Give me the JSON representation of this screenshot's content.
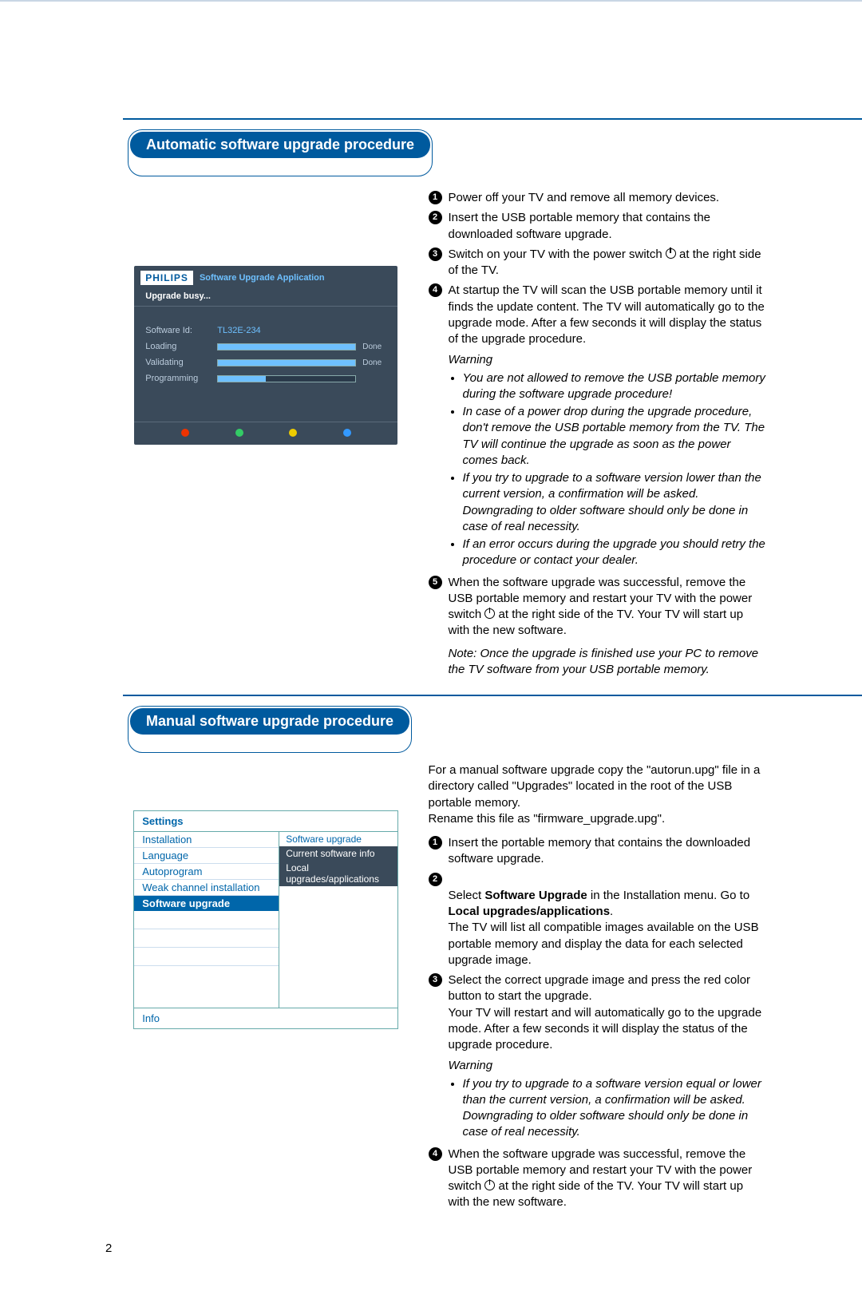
{
  "page_number": "2",
  "section1": {
    "title": "Automatic software upgrade procedure",
    "tv": {
      "brand": "PHILIPS",
      "app_title": "Software Upgrade Application",
      "status": "Upgrade busy...",
      "software_id_label": "Software Id:",
      "software_id_value": "TL32E-234",
      "loading_label": "Loading",
      "loading_done": "Done",
      "loading_pct": 100,
      "validating_label": "Validating",
      "validating_done": "Done",
      "validating_pct": 100,
      "programming_label": "Programming",
      "programming_pct": 35
    },
    "steps": {
      "1": "Power off your TV and remove all memory devices.",
      "2": "Insert the USB portable memory that contains the downloaded software upgrade.",
      "3_a": "Switch on your TV with the power switch ",
      "3_b": " at the right side of the TV.",
      "4": "At startup the TV will scan the USB portable memory until it finds the update content. The TV will automatically go to the upgrade mode. After a few seconds it will display the status of the upgrade procedure.",
      "warning_label": "Warning",
      "warnings": [
        "You are not allowed to remove the USB portable memory during the software upgrade procedure!",
        "In case of a power drop during the upgrade procedure, don't remove the USB portable memory from the TV. The TV will continue the upgrade as soon as the power comes back.",
        "If you try to upgrade to a software version lower than the current version, a confirmation will be asked. Downgrading to older software should only be done in case of real necessity.",
        "If an error occurs during the upgrade you should retry the procedure or contact your dealer."
      ],
      "5_a": "When the software upgrade was successful, remove the USB portable memory and restart your TV with the power switch ",
      "5_b": " at the right side of the TV. Your TV will start up with the new software.",
      "note": "Note: Once the upgrade is finished use your PC to remove the TV software from your USB portable memory."
    }
  },
  "section2": {
    "title": "Manual software upgrade procedure",
    "intro": "For a manual software upgrade copy the \"autorun.upg\" file in a directory called \"Upgrades\" located in the root of the USB portable memory.\nRename this file as \"firmware_upgrade.upg\".",
    "menu": {
      "header": "Settings",
      "left": [
        "Installation",
        "Language",
        "Autoprogram",
        "Weak channel installation",
        "Software upgrade"
      ],
      "left_active_index": 4,
      "right": [
        "Software upgrade",
        "Current software info",
        "Local upgrades/applications"
      ],
      "footer": "Info"
    },
    "steps": {
      "1": "Insert the portable memory that contains the downloaded software upgrade.",
      "2_a": "Select ",
      "2_bold1": "Software Upgrade",
      "2_b": " in the Installation menu. Go to ",
      "2_bold2": "Local upgrades/applications",
      "2_c": ".\nThe TV will list all compatible images available on the USB portable memory and display the data for each selected upgrade image.",
      "3": "Select the correct upgrade image and press the red color button to start the upgrade.\nYour TV will restart and will automatically go to the upgrade mode. After a few seconds it will display the status of the upgrade procedure.",
      "warning_label": "Warning",
      "warnings": [
        "If you try to upgrade to a software version equal or lower than the current version, a confirmation will be asked. Downgrading to older software should only be done in case of real necessity."
      ],
      "4_a": "When the software upgrade was successful, remove the USB portable memory and restart your TV with the power switch ",
      "4_b": " at the right side of the TV. Your TV will start up with the new software."
    }
  }
}
